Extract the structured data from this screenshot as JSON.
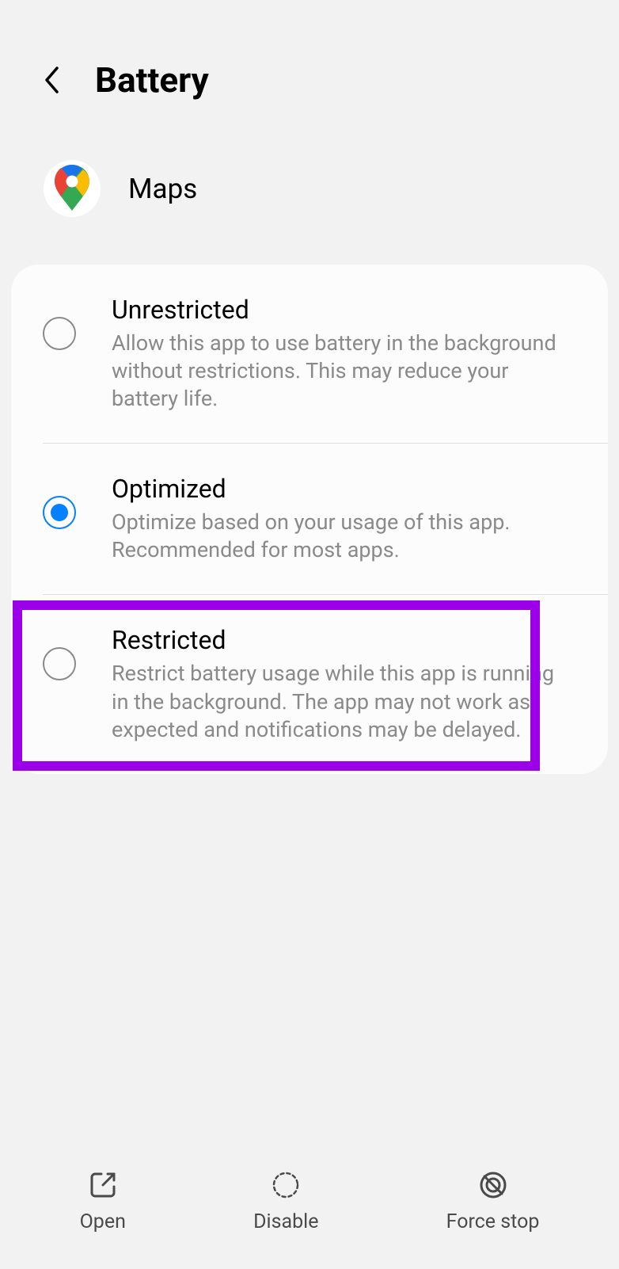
{
  "header": {
    "title": "Battery"
  },
  "app": {
    "name": "Maps"
  },
  "options": [
    {
      "title": "Unrestricted",
      "description": "Allow this app to use battery in the background without restrictions. This may reduce your battery life.",
      "selected": false
    },
    {
      "title": "Optimized",
      "description": "Optimize based on your usage of this app. Recommended for most apps.",
      "selected": true
    },
    {
      "title": "Restricted",
      "description": "Restrict battery usage while this app is running in the background. The app may not work as expected and notifications may be delayed.",
      "selected": false
    }
  ],
  "bottomActions": {
    "open": "Open",
    "disable": "Disable",
    "forceStop": "Force stop"
  }
}
